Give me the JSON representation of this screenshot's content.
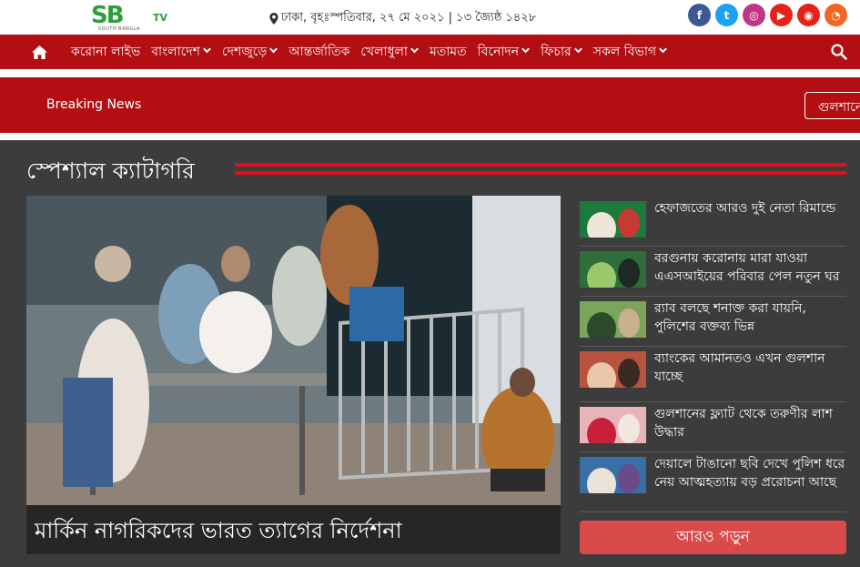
{
  "header": {
    "logo_text": "SB",
    "logo_tv": "TV",
    "logo_sub": "SOUTH BANGLA",
    "dateline": "ঢাকা, বৃহঃস্পতিবার, ২৭ মে ২০২১ | ১৩ জ্যৈষ্ঠ ১৪২৮",
    "socials": [
      {
        "name": "facebook-icon",
        "glyph": "f",
        "color": "#3b5998"
      },
      {
        "name": "twitter-icon",
        "glyph": "t",
        "color": "#1da1f2"
      },
      {
        "name": "instagram-icon",
        "glyph": "◎",
        "color": "#c13584"
      },
      {
        "name": "youtube-icon",
        "glyph": "▶",
        "color": "#e62117"
      },
      {
        "name": "podcast-icon",
        "glyph": "◉",
        "color": "#e62117"
      },
      {
        "name": "rss-icon",
        "glyph": "◔",
        "color": "#f26522"
      }
    ]
  },
  "nav": {
    "items": [
      {
        "label": "করোনা লাইভ",
        "dropdown": false
      },
      {
        "label": "বাংলাদেশ",
        "dropdown": true
      },
      {
        "label": "দেশজুড়ে",
        "dropdown": true
      },
      {
        "label": "আন্তর্জাতিক",
        "dropdown": false
      },
      {
        "label": "খেলাধুলা",
        "dropdown": true
      },
      {
        "label": "মতামত",
        "dropdown": false
      },
      {
        "label": "বিনোদন",
        "dropdown": true
      },
      {
        "label": "ফিচার",
        "dropdown": true
      },
      {
        "label": "সকল বিভাগ",
        "dropdown": true
      }
    ]
  },
  "breaking": {
    "label": "Breaking News",
    "ticker": "গুলশানের"
  },
  "section": {
    "title": "স্পেশ্যাল ক্যাটাগরি",
    "hero_caption": "মার্কিন নাগরিকদের ভারত ত্যাগের নির্দেশনা",
    "more_button": "আরও পড়ুন",
    "side_items": [
      {
        "text": "হেফাজতের আরও দুই নেতা রিমান্ডে"
      },
      {
        "text": "বরগুনায় করোনায় মারা যাওয়া এএসআইয়ের পরিবার পেল নতুন ঘর"
      },
      {
        "text": "র‌্যাব বলছে শনাক্ত করা যায়নি, পুলিশের বক্তব্য ভিন্ন"
      },
      {
        "text": "ব্যাংকের আমানতও এখন গুলশান যাচ্ছে"
      },
      {
        "text": "গুলশানের ফ্ল্যাট থেকে তরুণীর লাশ উদ্ধার"
      },
      {
        "text": "দেয়ালে টাঙানো ছবি দেখে পুলিশ ধরে নেয় আত্মহত্যায় বড় প্ররোচনা আছে"
      }
    ]
  }
}
